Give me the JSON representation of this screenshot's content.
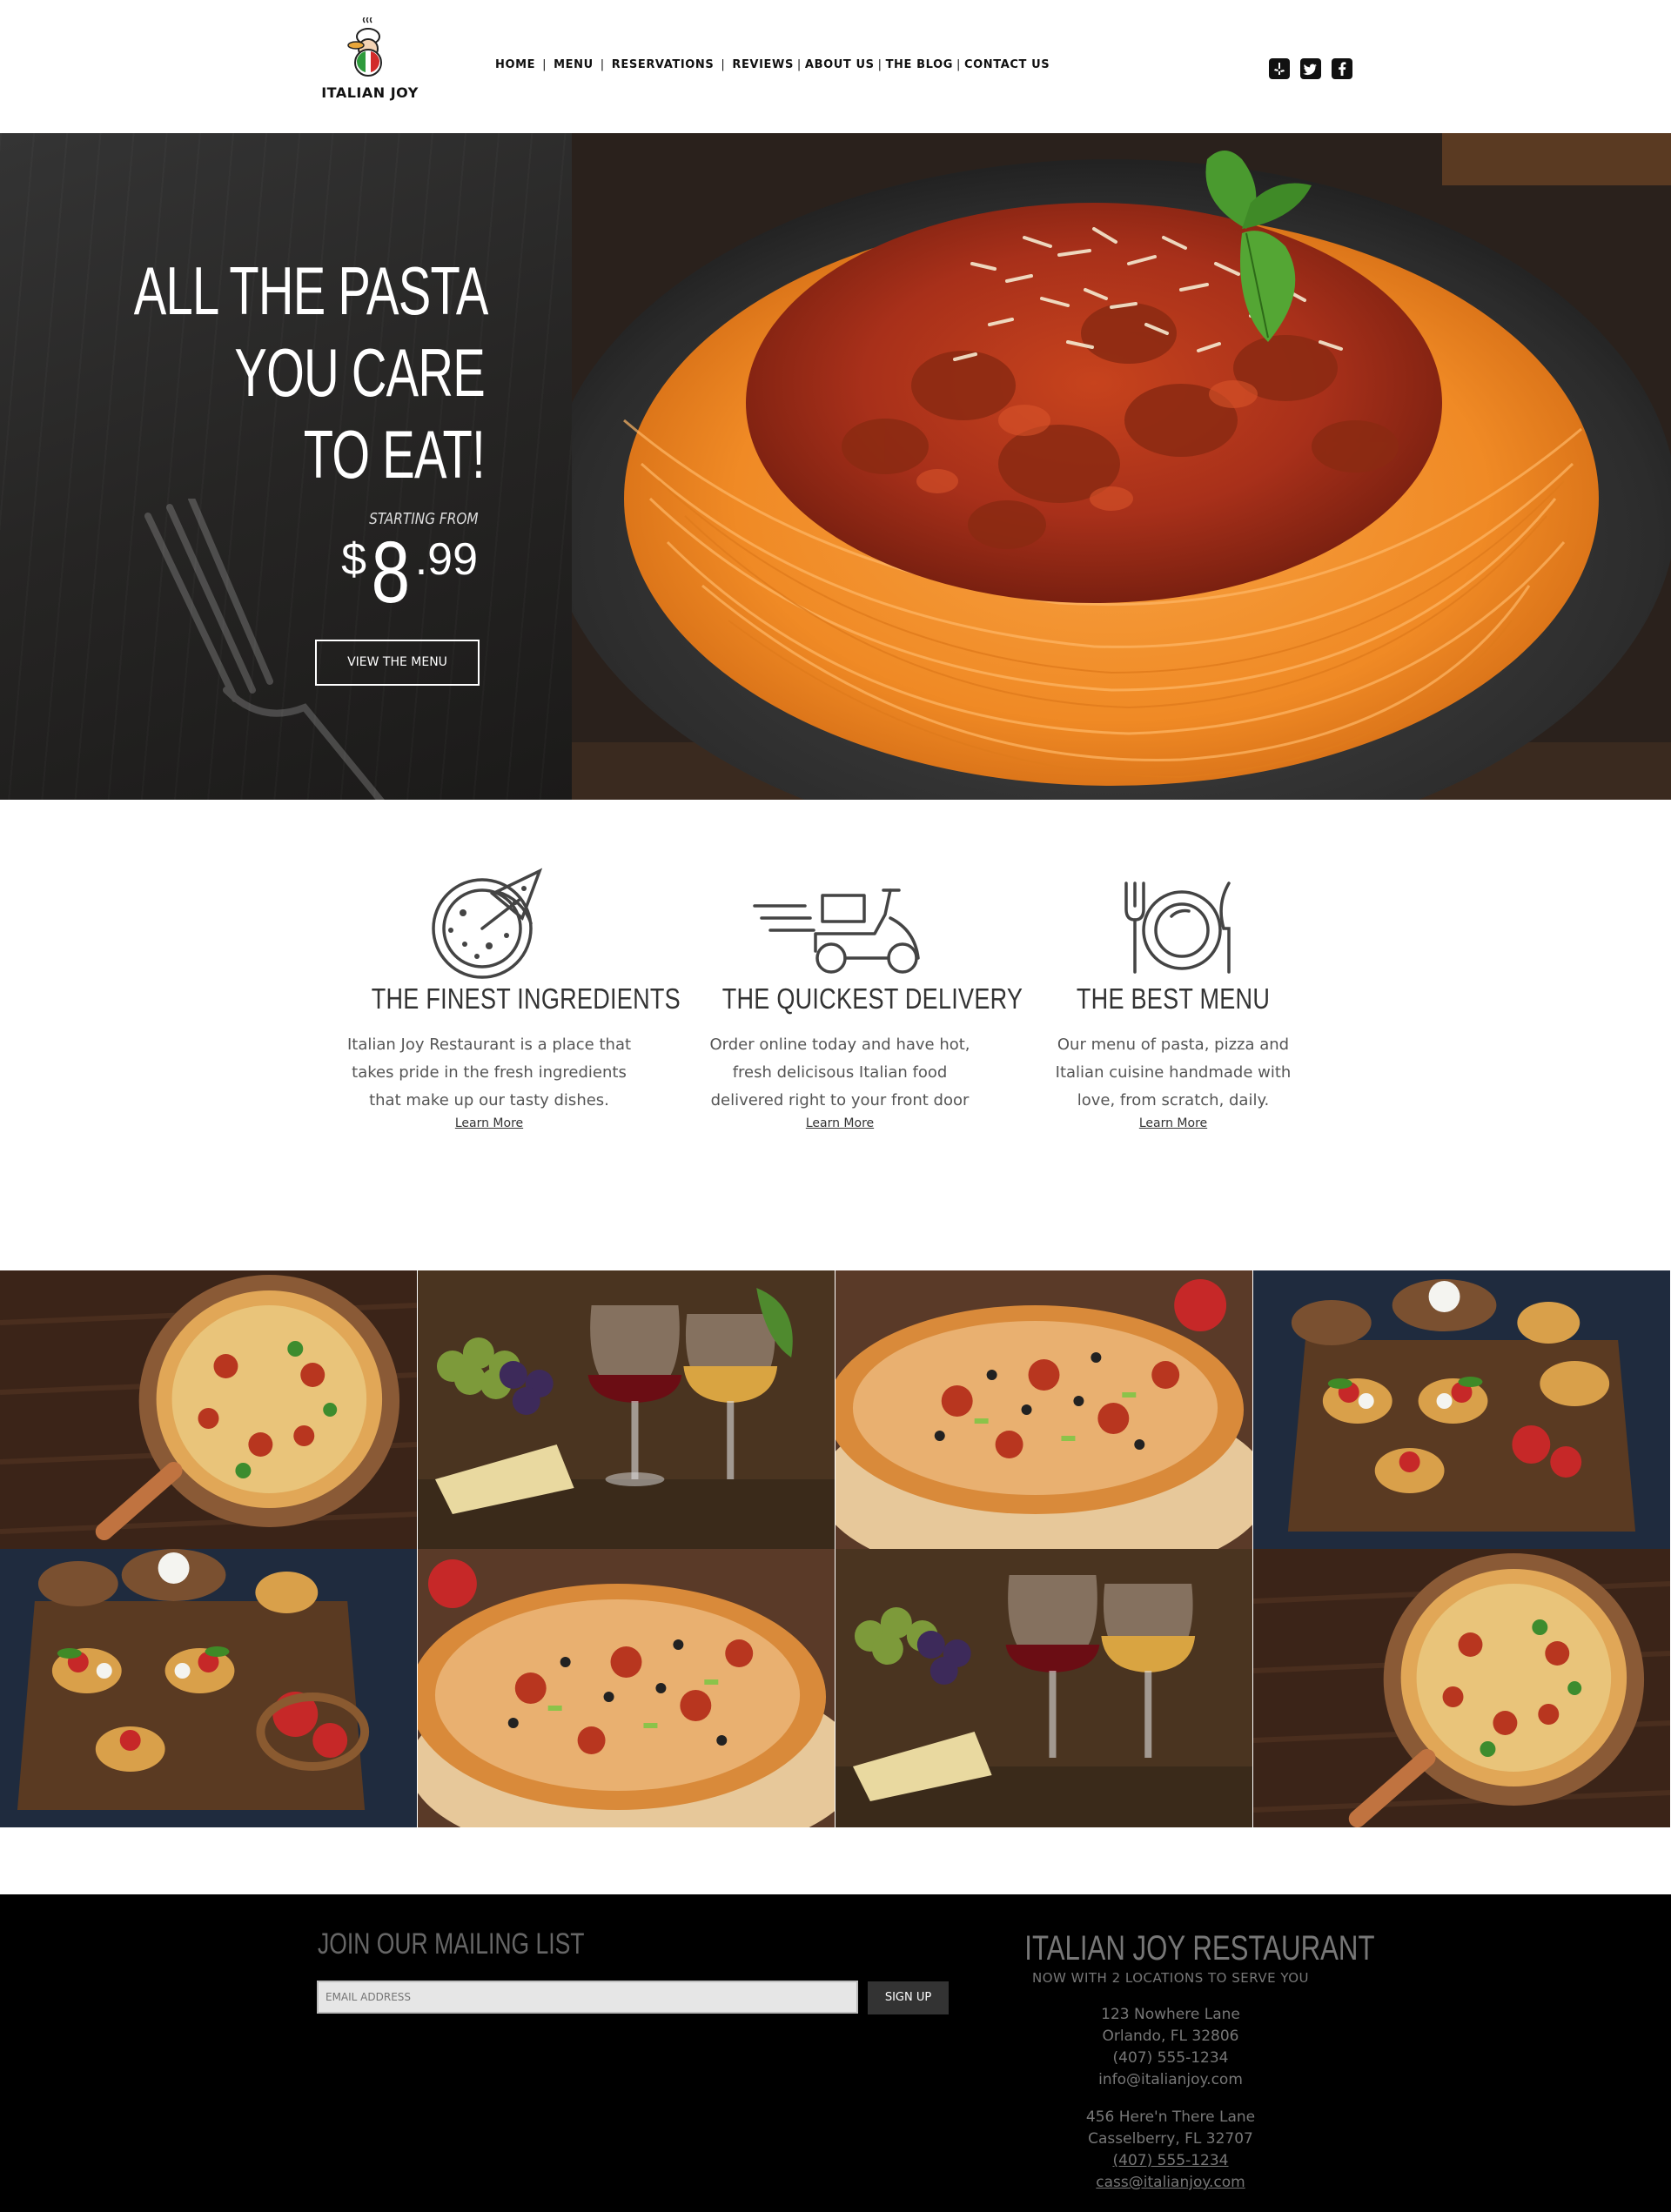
{
  "header": {
    "logo_text": "ITALIAN JOY",
    "nav": [
      {
        "label": "HOME"
      },
      {
        "label": "MENU"
      },
      {
        "label": "RESERVATIONS"
      },
      {
        "label": "REVIEWS"
      },
      {
        "label": "ABOUT US"
      },
      {
        "label": "THE BLOG"
      },
      {
        "label": "CONTACT US"
      }
    ],
    "nav_separator": "|",
    "social": [
      {
        "icon": "yelp-icon"
      },
      {
        "icon": "twitter-icon"
      },
      {
        "icon": "facebook-icon"
      }
    ]
  },
  "hero": {
    "title_lines": [
      "ALL THE PASTA",
      "YOU CARE",
      "TO EAT!"
    ],
    "starting_from": "STARTING FROM",
    "price_currency": "$",
    "price_whole": "8",
    "price_cents": ".99",
    "button_label": "VIEW THE MENU"
  },
  "features": [
    {
      "icon": "pizza-icon",
      "title": "THE FINEST INGREDIENTS",
      "lines": [
        "Italian Joy Restaurant is a place that",
        "takes pride in the fresh ingredients",
        "that make up our tasty dishes."
      ],
      "link": "Learn More"
    },
    {
      "icon": "delivery-scooter-icon",
      "title": "THE QUICKEST DELIVERY",
      "lines": [
        "Order online today and have hot,",
        "fresh delicisous Italian food",
        "delivered right to your front door"
      ],
      "link": "Learn More"
    },
    {
      "icon": "plate-cutlery-icon",
      "title": "THE BEST MENU",
      "lines": [
        "Our menu of pasta, pizza and",
        "Italian cuisine handmade with",
        "love, from scratch, daily."
      ],
      "link": "Learn More"
    }
  ],
  "gallery": [
    {
      "subject": "pizza-board-photo"
    },
    {
      "subject": "wine-glasses-photo"
    },
    {
      "subject": "pizza-closeup-photo"
    },
    {
      "subject": "bruschetta-photo"
    },
    {
      "subject": "bruschetta-photo"
    },
    {
      "subject": "pizza-closeup-photo"
    },
    {
      "subject": "wine-glasses-photo"
    },
    {
      "subject": "pizza-board-photo"
    }
  ],
  "footer": {
    "mailing_title": "JOIN OUR MAILING LIST",
    "email_placeholder": "EMAIL ADDRESS",
    "signup_label": "SIGN UP",
    "restaurant_name": "ITALIAN JOY RESTAURANT",
    "restaurant_sub": "NOW WITH 2 LOCATIONS TO SERVE YOU",
    "location1": {
      "street": "123 Nowhere Lane",
      "city": "Orlando, FL 32806",
      "phone": "(407) 555-1234",
      "email": "info@italianjoy.com"
    },
    "location2": {
      "street": "456 Here'n There Lane",
      "city": "Casselberry, FL 32707",
      "phone": "(407) 555-1234",
      "email": "cass@italianjoy.com"
    }
  },
  "colors": {
    "footer_bg": "#000000",
    "hero_panel_bg": "#262524",
    "text_dark": "#333333",
    "footer_text": "#777777"
  }
}
